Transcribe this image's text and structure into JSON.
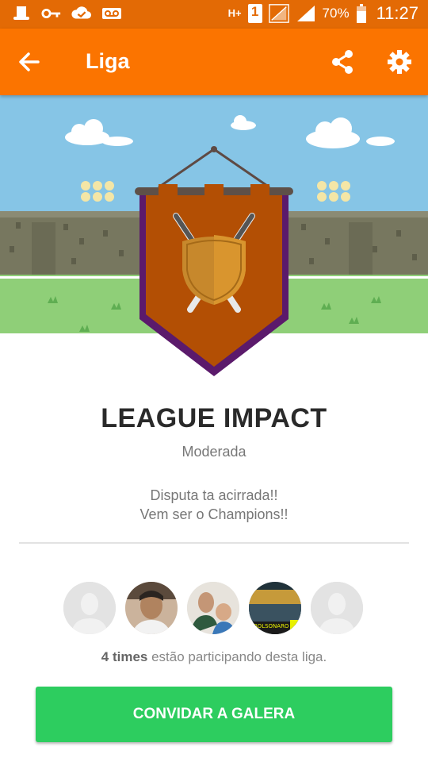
{
  "status_bar": {
    "network": "H+",
    "sim": "1",
    "battery": "70%",
    "time": "11:27",
    "icons": [
      "hat-icon",
      "key-icon",
      "cloud-check-icon",
      "voicemail-icon",
      "signal-icon",
      "battery-icon"
    ]
  },
  "app_bar": {
    "title": "Liga",
    "background": "#fb7400",
    "icons": [
      "back-arrow-icon",
      "share-icon",
      "settings-gear-icon"
    ]
  },
  "league": {
    "name": "LEAGUE IMPACT",
    "type": "Moderada",
    "description_line1": "Disputa ta acirrada!!",
    "description_line2": "Vem ser o Champions!!"
  },
  "participants": {
    "count_label": "4 times",
    "text": " estão participando desta liga.",
    "avatars": [
      "default-avatar",
      "user-photo-1",
      "user-photo-2",
      "user-photo-3",
      "default-avatar"
    ]
  },
  "invite_button": {
    "label": "CONVIDAR A GALERA",
    "color": "#2dcd5f"
  }
}
